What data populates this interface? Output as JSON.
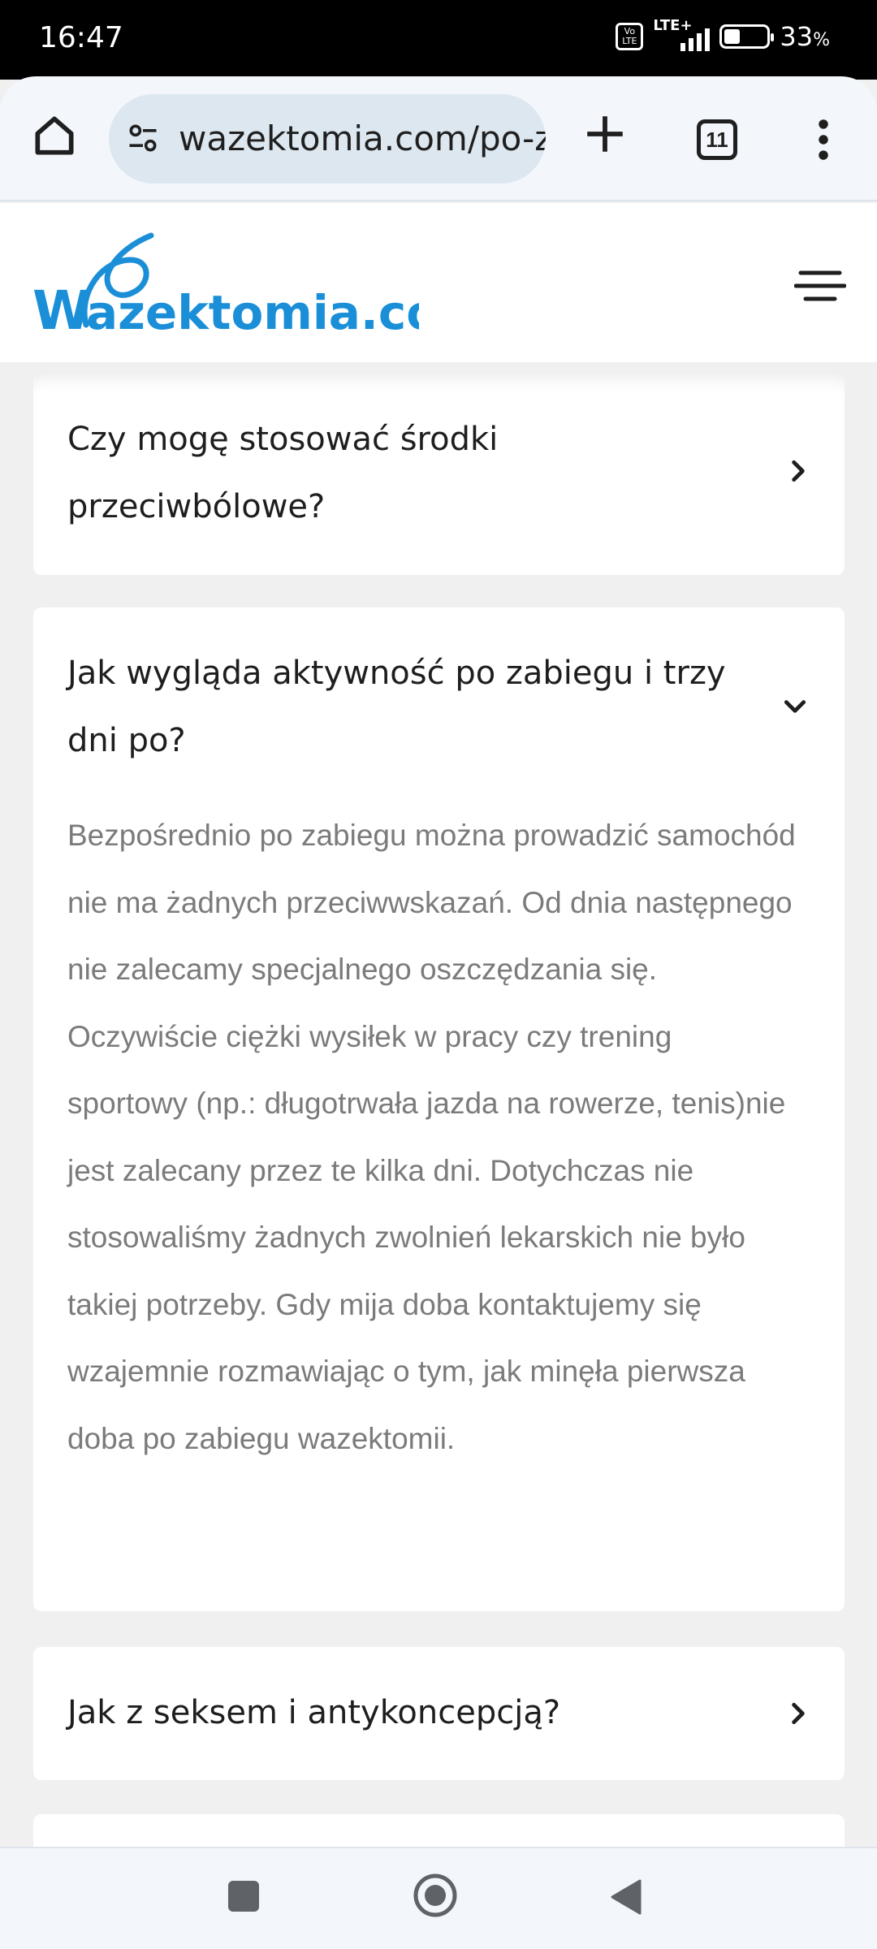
{
  "status_bar": {
    "time": "16:47",
    "volte_label": "Vo LTE",
    "network": "LTE+",
    "battery_percent": "33",
    "battery_unit": "%",
    "battery_level": 0.33
  },
  "browser": {
    "url": "wazektomia.com/po-z",
    "tab_count": "11",
    "icons": [
      "home-icon",
      "site-settings-icon",
      "new-tab-plus-icon",
      "tab-switcher-icon",
      "more-vert-icon"
    ]
  },
  "site": {
    "logo_text": "Wazektomia.com",
    "brand_color": "#1a8fd8"
  },
  "faq": [
    {
      "question": "Czy mogę stosować środki przeciwbólowe?",
      "expanded": false
    },
    {
      "question": "Jak wygląda aktywność po zabiegu i trzy dni po?",
      "expanded": true,
      "answer": "Bezpośrednio po zabiegu można prowadzić samochód nie ma żadnych przeciwwskazań. Od dnia następnego nie zalecamy specjalnego oszczędzania się. Oczywiście ciężki wysiłek w pracy czy trening sportowy (np.: długotrwała jazda na rowerze, tenis)nie jest zalecany przez te kilka dni. Dotychczas nie stosowaliśmy żadnych zwolnień lekarskich nie było takiej potrzeby. Gdy mija doba kontaktujemy się wzajemnie rozmawiając o tym, jak minęła pierwsza doba po zabiegu wazektomii."
    },
    {
      "question": "Jak z seksem i antykoncepcją?",
      "expanded": false
    }
  ],
  "nav": {
    "icons": [
      "recents-square-icon",
      "home-circle-icon",
      "back-triangle-icon"
    ]
  }
}
